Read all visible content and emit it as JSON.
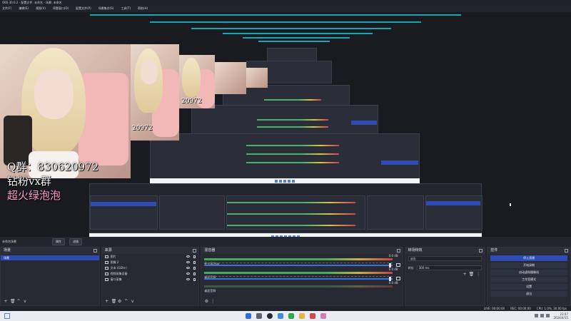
{
  "window": {
    "title": "OBS 30.0.2 - 配置文件: 未命名 - 场景: 未命名"
  },
  "menu": [
    "文件(F)",
    "编辑(E)",
    "视图(V)",
    "停靠窗口(D)",
    "配置文件(P)",
    "场景集合(S)",
    "工具(T)",
    "帮助(H)"
  ],
  "overlay": {
    "qq_line": "Q群：830620972",
    "vx_line": "钻粉vx群",
    "group_line": "超火绿泡泡",
    "watermark_1": "20972",
    "watermark_2": "20972"
  },
  "scene_bar": {
    "scene_label": "未命名场景",
    "prop_button": "属性",
    "filter_button": "滤镜"
  },
  "scenes_dock": {
    "title": "场景",
    "items": [
      {
        "label": "场景"
      }
    ]
  },
  "sources_dock": {
    "title": "来源",
    "items": [
      {
        "label": "图片"
      },
      {
        "label": "图像 2"
      },
      {
        "label": "文本 (GDI+)"
      },
      {
        "label": "视频采集设备"
      },
      {
        "label": "窗口采集"
      }
    ]
  },
  "mixer_dock": {
    "title": "混音器",
    "channels": [
      {
        "name": "麦克风/Aux",
        "db": "0.0 dB"
      },
      {
        "name": "桌面音频",
        "db": "0.0 dB"
      },
      {
        "name": "桌面音频",
        "db": "0.0 dB"
      }
    ]
  },
  "transitions_dock": {
    "title": "转场特效",
    "type": "淡出",
    "duration_label": "时长",
    "duration_value": "300 ms"
  },
  "controls_dock": {
    "title": "控件",
    "buttons": [
      "停止直播",
      "开始录制",
      "启动虚拟摄像机",
      "工作室模式",
      "设置",
      "退出"
    ]
  },
  "status": {
    "live": "LIVE: 00:00:00",
    "rec": "REC: 00:00:00",
    "cpu": "CPU: 1.0%, 30.00 fps"
  },
  "taskbar": {
    "time": "23:47",
    "date": "2024/4/15"
  },
  "colors": {
    "accent": "#2f4cb4",
    "stop": "#c8322f",
    "cyan_bars": "#18a6b4"
  }
}
